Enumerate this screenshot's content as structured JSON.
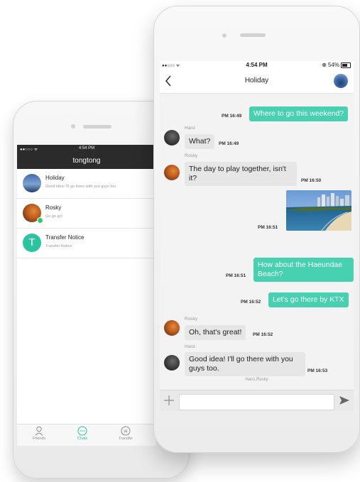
{
  "back_phone": {
    "status_time": "4:54 PM",
    "signal": "●●○○○ ᯤ",
    "title": "tongtong",
    "conversations": [
      {
        "name": "Holiday",
        "preview": "Good idea! I'll go there with you guys too."
      },
      {
        "name": "Rosky",
        "preview": "Go go go!"
      },
      {
        "name": "Transfer Notice",
        "preview": "Transfer Notice",
        "avatar_letter": "T"
      }
    ],
    "tabs": [
      {
        "label": "Friends",
        "icon": "person-icon"
      },
      {
        "label": "Chats",
        "icon": "chat-icon",
        "active": true
      },
      {
        "label": "Transfer",
        "icon": "transfer-icon"
      }
    ]
  },
  "front_phone": {
    "status": {
      "signal": "●●○○○ ᯤ",
      "time": "4:54 PM",
      "battery": "54%"
    },
    "title": "Holiday",
    "messages": [
      {
        "dir": "out",
        "text": "Where to go this weekend?",
        "time": "PM 16:49"
      },
      {
        "dir": "in",
        "sender": "Hanz",
        "text": "What?",
        "time": "PM 16:49"
      },
      {
        "dir": "in",
        "sender": "Rosky",
        "text": "The day to play together, isn't it?",
        "time": "PM 16:50"
      },
      {
        "dir": "out",
        "type": "image",
        "time": "PM 16:51"
      },
      {
        "dir": "out",
        "text": "How about the Haeundae Beach?",
        "time": "PM 16:51"
      },
      {
        "dir": "out",
        "text": "Let's go there by KTX",
        "time": "PM 16:52"
      },
      {
        "dir": "in",
        "sender": "Rosky",
        "text": "Oh, that's great!",
        "time": "PM 16:52"
      },
      {
        "dir": "in",
        "sender": "Hanz",
        "text": "Good idea! I'll go there with you guys too.",
        "time": "PM 16:53"
      }
    ],
    "members": "Hanz,Rosky",
    "input_placeholder": ""
  },
  "colors": {
    "accent": "#47d1b1",
    "dark_header": "#2b2b2b",
    "transfer_avatar": "#2cc3a0"
  }
}
